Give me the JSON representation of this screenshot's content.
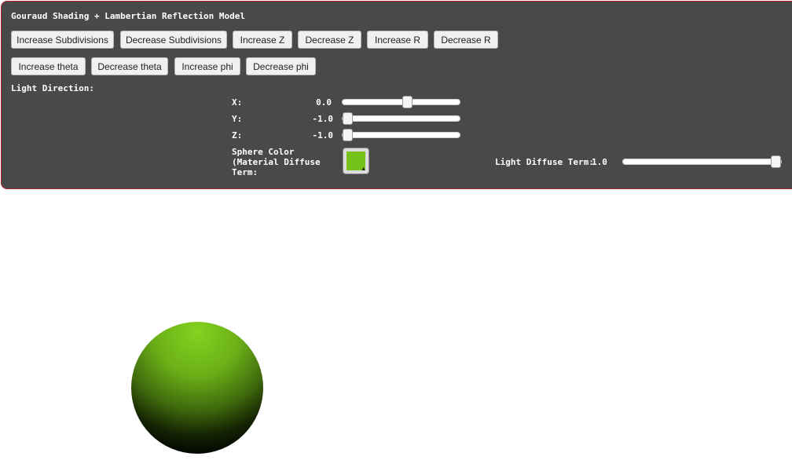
{
  "title": "Gouraud Shading + Lambertian Reflection Model",
  "buttons_row1": [
    "Increase Subdivisions",
    "Decrease Subdivisions",
    "Increase Z",
    "Decrease Z",
    "Increase R",
    "Decrease R"
  ],
  "buttons_row2": [
    "Increase theta",
    "Decrease theta",
    "Increase phi",
    "Decrease phi"
  ],
  "light_direction": {
    "heading": "Light Direction:",
    "x": {
      "label": "X:",
      "value": "0.0",
      "fraction": 0.5
    },
    "y": {
      "label": "Y:",
      "value": "-1.0",
      "fraction": 0.0
    },
    "z": {
      "label": "Z:",
      "value": "-1.0",
      "fraction": 0.0
    }
  },
  "sphere_color": {
    "label_lines": [
      "Sphere Color",
      "(Material Diffuse",
      "Term:"
    ],
    "color": "#74c11a"
  },
  "light_diffuse": {
    "label": "Light Diffuse Term:",
    "value": "1.0",
    "fraction": 1.0
  },
  "colors": {
    "panel": "#494949",
    "panel_border": "#b3262b",
    "sphere": "#74c11a"
  }
}
